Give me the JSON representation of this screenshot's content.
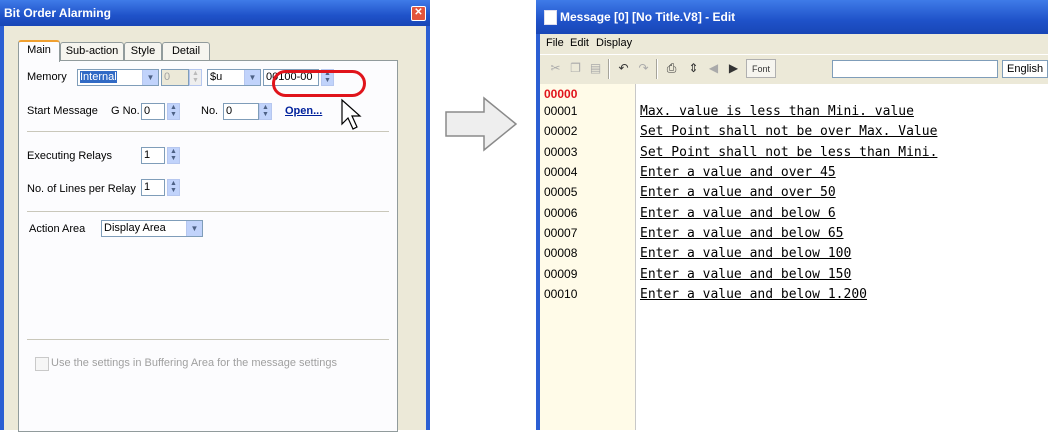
{
  "dialog": {
    "title": "Bit Order Alarming",
    "tabs": [
      "Main",
      "Sub-action",
      "Style",
      "Detail"
    ],
    "memory_label": "Memory",
    "memory_type": "Internal",
    "memory_number": "0",
    "memory_prefix": "$u",
    "memory_address": "00100-00",
    "start_message_label": "Start Message",
    "gno_label": "G No.",
    "gno_value": "0",
    "no_label": "No.",
    "no_value": "0",
    "open_label": "Open...",
    "executing_relays_label": "Executing Relays",
    "executing_relays_value": "1",
    "lines_per_relay_label": "No. of Lines per Relay",
    "lines_per_relay_value": "1",
    "action_area_label": "Action Area",
    "action_area_value": "Display Area",
    "buffering_checkbox_label": "Use the settings in Buffering Area for the message settings",
    "close_glyph": "✕"
  },
  "editor": {
    "title": "Message [0] [No Title.V8] - Edit",
    "menus": [
      "File",
      "Edit",
      "Display"
    ],
    "font_button": "Font",
    "language": "English",
    "lines": [
      {
        "num": "00000",
        "text": ""
      },
      {
        "num": "00001",
        "text": "Max. value is less than Mini. value"
      },
      {
        "num": "00002",
        "text": "Set Point shall not be over Max. Value"
      },
      {
        "num": "00003",
        "text": "Set Point shall not be less than Mini. "
      },
      {
        "num": "00004",
        "text": "Enter a value and over 45"
      },
      {
        "num": "00005",
        "text": "Enter a value and over 50"
      },
      {
        "num": "00006",
        "text": "Enter a value and below 6"
      },
      {
        "num": "00007",
        "text": "Enter a value and below 65"
      },
      {
        "num": "00008",
        "text": "Enter a value and below 100"
      },
      {
        "num": "00009",
        "text": "Enter a value and below 150"
      },
      {
        "num": "00010",
        "text": "Enter a value and below 1.200"
      }
    ]
  },
  "colors": {
    "title_bar": "#1f52c9",
    "highlight_oval": "#e0141b",
    "current_line": "#e0141b"
  }
}
